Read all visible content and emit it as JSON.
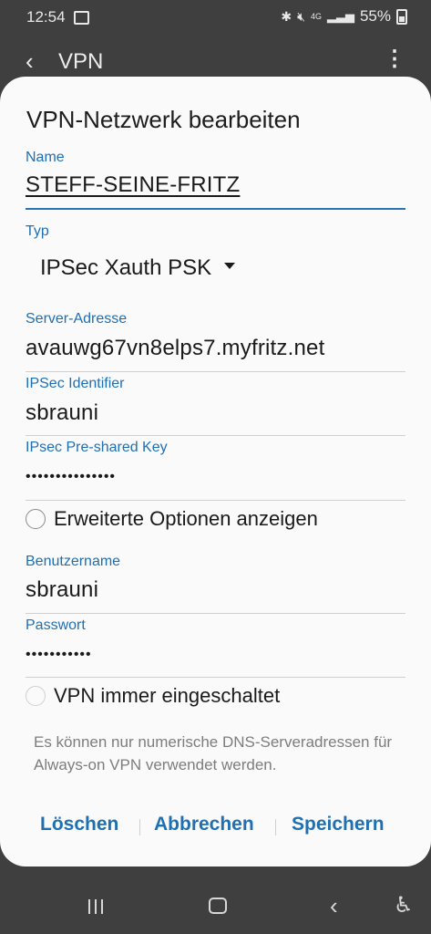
{
  "status": {
    "time": "12:54",
    "battery": "55%",
    "network": "4G"
  },
  "appbar": {
    "title": "VPN"
  },
  "dialog": {
    "title": "VPN-Netzwerk bearbeiten",
    "name_label": "Name",
    "name_value": "STEFF-SEINE-FRITZ",
    "type_label": "Typ",
    "type_value": "IPSec Xauth PSK",
    "server_label": "Server-Adresse",
    "server_value": "avauwg67vn8elps7.myfritz.net",
    "ipsec_id_label": "IPSec Identifier",
    "ipsec_id_value": "sbrauni",
    "psk_label": "IPsec Pre-shared Key",
    "psk_value": "•••••••••••••••",
    "advanced_label": "Erweiterte Optionen anzeigen",
    "user_label": "Benutzername",
    "user_value": "sbrauni",
    "password_label": "Passwort",
    "password_value": "•••••••••••",
    "always_on_label": "VPN immer eingeschaltet",
    "info_text": "Es können nur numerische DNS-Serveradressen für Always-on VPN verwendet werden.",
    "buttons": {
      "delete": "Löschen",
      "cancel": "Abbrechen",
      "save": "Speichern"
    }
  }
}
